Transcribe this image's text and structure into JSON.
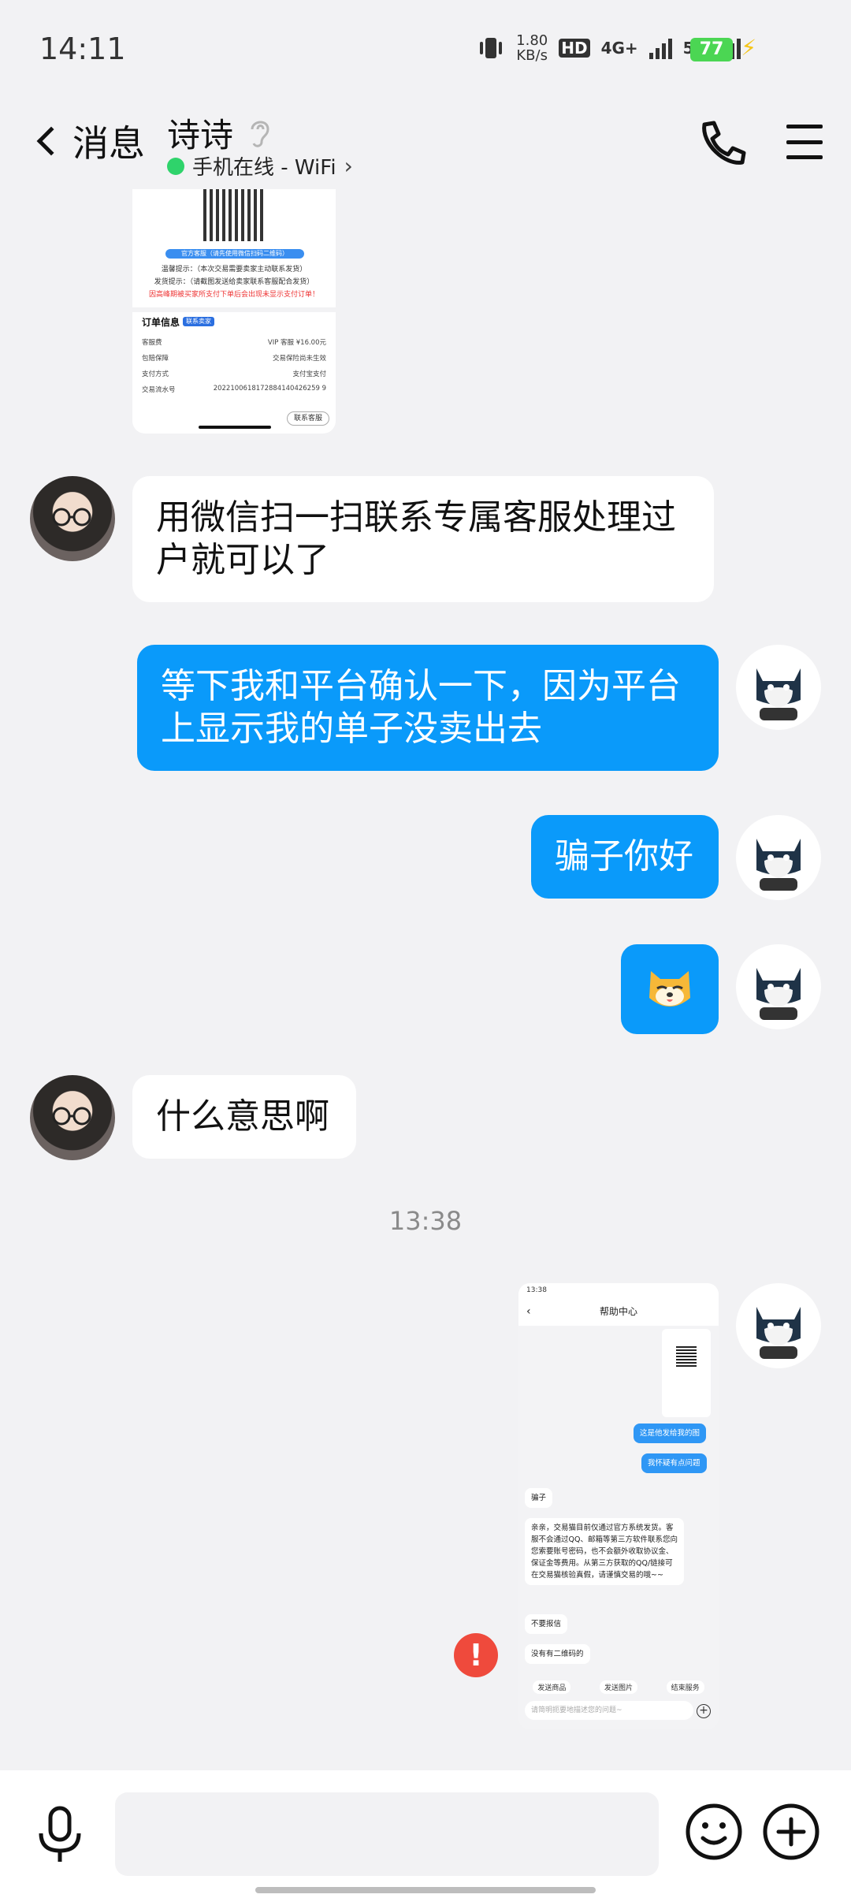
{
  "status_bar": {
    "time": "14:11",
    "net_speed_value": "1.80",
    "net_speed_unit": "KB/s",
    "hd_label": "HD",
    "network_1": "4G+",
    "network_2": "5G",
    "battery": "77"
  },
  "header": {
    "back_label": "消息",
    "contact_name": "诗诗",
    "presence": "手机在线 - WiFi",
    "presence_color": "#2fd36b"
  },
  "chat": {
    "top_image": {
      "pill_text": "官方客服（请先使用微信扫码二维码）",
      "tip_1": "温馨提示：（本次交易需要卖家主动联系发货）",
      "tip_2": "发货提示：（请截图发送给卖家联系客服配合发货）",
      "warning": "因高峰期被买家所支付下单后会出现未显示支付订单！",
      "order_title": "订单信息",
      "order_tag": "联系卖家",
      "rows": [
        {
          "label": "客服费",
          "value": "VIP 客服 ¥16.00元"
        },
        {
          "label": "包赔保障",
          "value": "交易保险尚未生效"
        },
        {
          "label": "支付方式",
          "value": "支付宝支付"
        },
        {
          "label": "交易流水号",
          "value": "2022100618172884140426259 9"
        }
      ],
      "contact_button": "联系客服"
    },
    "messages": [
      {
        "side": "left",
        "text": "用微信扫一扫联系专属客服处理过户就可以了"
      },
      {
        "side": "right",
        "text": "等下我和平台确认一下，因为平台上显示我的单子没卖出去"
      },
      {
        "side": "right",
        "text": "骗子你好"
      },
      {
        "side": "left",
        "text": "什么意思啊"
      }
    ],
    "timestamp": "13:38",
    "help_center": {
      "status_time": "13:38",
      "title": "帮助中心",
      "msg_r1": "这是他发给我的图",
      "msg_r2": "我怀疑有点问题",
      "msg_l1": "骗子",
      "msg_l2": "亲亲，交易猫目前仅通过官方系统发货。客服不会通过QQ、邮箱等第三方软件联系您向您索要账号密码，也不会额外收取协议金、保证金等费用。从第三方获取的QQ/链接可在交易猫核验真假，请谨慎交易的哦~~",
      "msg_l3": "不要报信",
      "msg_l4": "没有有二维码的",
      "action_1": "发送商品",
      "action_2": "发送图片",
      "action_3": "结束服务",
      "input_placeholder": "请简明扼要地描述您的问题~"
    },
    "error_mark": "!"
  },
  "colors": {
    "accent_blue": "#0a9afa",
    "background": "#f2f2f4",
    "error_red": "#ef4a3c"
  }
}
